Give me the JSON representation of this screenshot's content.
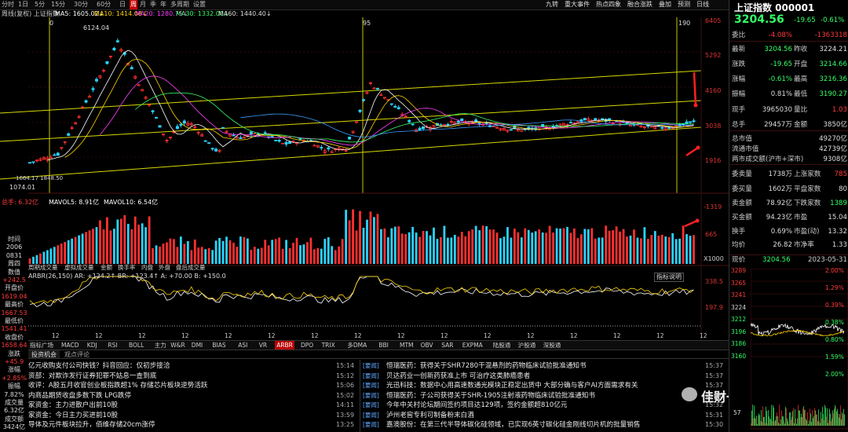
{
  "toolbar": {
    "timeframes": [
      "分时",
      "1日",
      "5分",
      "15分",
      "30分",
      "60分",
      "日",
      "周",
      "月",
      "季",
      "年",
      "多周期",
      "设置"
    ],
    "active_tf": "周",
    "right_items": [
      "九转",
      "重大事件",
      "热点四象",
      "融合涨跌",
      "叠加",
      "预测",
      "日线"
    ]
  },
  "legend": {
    "name": "周线(复权) 上证指数",
    "ma5": "MA5: 1605.02↓",
    "ma10": "MA10: 1414.08↓",
    "ma20": "MA20: 1280.75↓",
    "ma30": "MA30: 1332.00↓",
    "ma60": "MA60: 1440.40↓"
  },
  "chart_axis": {
    "price_labels": [
      "6405",
      "5292",
      "4160",
      "3038",
      "1916"
    ],
    "price_right_labels": [
      "-1319",
      "665"
    ],
    "vol_unit": "X1000",
    "ind_labels": [
      "338.5",
      "197.9"
    ],
    "peak_label": "6124.04",
    "low_label": "1074.01",
    "low_label2": "1664.17 1848.50",
    "markers": [
      "0",
      "95",
      "190"
    ]
  },
  "volume_legend": {
    "total": "总手: 6.32亿",
    "mavol5": "MAVOL5: 8.91亿",
    "mavol10": "MAVOL10: 6.54亿"
  },
  "sub_tabs": [
    "周期成交量",
    "虚拟成交量",
    "金额",
    "换手率",
    "内盘",
    "外盘",
    "盘后成交量"
  ],
  "indicator": {
    "label": "ARBR(26,150) AR: +124.2↑ BR: +123.4↑ A: +70.00 B: +150.0",
    "explain": "指标说明",
    "ticks": [
      "12",
      "12",
      "12",
      "12",
      "12",
      "12",
      "12",
      "12",
      "12",
      "12",
      "12",
      "12",
      "12",
      "12",
      "12",
      "12"
    ]
  },
  "indicator_tabs": [
    "指标广场",
    "MACD",
    "KDJ",
    "RSI",
    "BOLL",
    "主力",
    "W&R",
    "DMI",
    "BIAS",
    "ASI",
    "VR",
    "ARBR",
    "DPO",
    "TRIX",
    "多DMA",
    "BBI",
    "MTM",
    "OBV",
    "SAR",
    "EXPMA",
    "陆股通",
    "沪股通",
    "深股通"
  ],
  "active_indicator": "ARBR",
  "left_info": [
    {
      "t": "时间",
      "c": "w"
    },
    {
      "t": "2006",
      "c": "w"
    },
    {
      "t": "0831",
      "c": "w"
    },
    {
      "t": "周四",
      "c": "w"
    },
    {
      "t": "数值",
      "c": "w"
    },
    {
      "t": "+242.5",
      "c": "r"
    },
    {
      "t": "开盘价",
      "c": "w"
    },
    {
      "t": "1619.04",
      "c": "r"
    },
    {
      "t": "最高价",
      "c": "w"
    },
    {
      "t": "1667.53",
      "c": "r"
    },
    {
      "t": "最低价",
      "c": "w"
    },
    {
      "t": "1541.41",
      "c": "r"
    },
    {
      "t": "收盘价",
      "c": "w"
    },
    {
      "t": "1658.64",
      "c": "r"
    },
    {
      "t": "涨跌",
      "c": "w"
    },
    {
      "t": "+45.9",
      "c": "r"
    },
    {
      "t": "涨幅",
      "c": "w"
    },
    {
      "t": "+2.85%",
      "c": "r"
    },
    {
      "t": "振幅",
      "c": "w"
    },
    {
      "t": "7.82%",
      "c": "w"
    },
    {
      "t": "成交量",
      "c": "w"
    },
    {
      "t": "6.32亿",
      "c": "w"
    },
    {
      "t": "成交额",
      "c": "w"
    },
    {
      "t": "3424亿",
      "c": "w"
    }
  ],
  "news_tabs": [
    "投资机会",
    "观点评论"
  ],
  "news_left": [
    {
      "text": "亿元收购支付公司快钱？抖音回应：仅初步接洽",
      "time": "15:14"
    },
    {
      "text": "资部：对欺诈发行证券犯罪不姑息一查到底",
      "time": "15:12"
    },
    {
      "text": "收评：A股五月收官创业板指跌超1% 存储芯片板块逆势活跃",
      "time": "15:06"
    },
    {
      "text": "内商品期货收盘多数下跌 LPG跌停",
      "time": "15:02"
    },
    {
      "text": "家资金：主力进散户出前10股",
      "time": "14:11"
    },
    {
      "text": "家资金：今日主力买进前10股",
      "time": "13:59"
    },
    {
      "text": "导体及元件板块拉升，佰维存储20cm涨停",
      "time": "13:25"
    }
  ],
  "news_right": [
    {
      "tag": "[要闻]",
      "text": "恒瑞医药：获得关于SHR7280干混悬剂的药物临床试验批准通知书",
      "time": "15:37"
    },
    {
      "tag": "[要闻]",
      "text": "贝达药业一创新药获准上市 可治疗这类肺癌患者",
      "time": "15:37"
    },
    {
      "tag": "[要闻]",
      "text": "光迅科技：数据中心用高速数通光模块正稳定出货中 大部分确与客户AI方面需求有关",
      "time": "15:37"
    },
    {
      "tag": "[要闻]",
      "text": "恒瑞医药：子公司获得关于SHR-1905注射液药物临床试验批准通知书",
      "time": "15:36"
    },
    {
      "tag": "[要闻]",
      "text": "今年中关村论坛期间签约项目达129项，签约金额超810亿元",
      "time": "15:32"
    },
    {
      "tag": "[要闻]",
      "text": "泸州老窖专利可制备粉末白酒",
      "time": "15:31"
    },
    {
      "tag": "[要闻]",
      "text": "嘉澳股份：在第三代半导体碳化硅领域，已实现6英寸碳化硅金刚线切片机的批量销售",
      "time": "15:30"
    }
  ],
  "watermark": "佳财一分钟",
  "panel": {
    "title": "上证指数 000001",
    "price": "3204.56",
    "change": "-19.65",
    "pct": "-0.61%",
    "rows": [
      {
        "l": "委比",
        "v": "-4.08%",
        "vc": "r",
        "l2": "",
        "v2": "-1363318",
        "v2c": "r"
      },
      {
        "l": "最新",
        "v": "3204.56",
        "vc": "g",
        "l2": "昨收",
        "v2": "3224.21",
        "v2c": "w"
      },
      {
        "l": "涨跌",
        "v": "-19.65",
        "vc": "g",
        "l2": "开盘",
        "v2": "3214.66",
        "v2c": "g"
      },
      {
        "l": "涨幅",
        "v": "-0.61%",
        "vc": "g",
        "l2": "最高",
        "v2": "3216.36",
        "v2c": "g"
      },
      {
        "l": "振幅",
        "v": "0.81%",
        "vc": "w",
        "l2": "最低",
        "v2": "3190.27",
        "v2c": "g"
      },
      {
        "l": "现手",
        "v": "3965030",
        "vc": "w",
        "l2": "量比",
        "v2": "1.03",
        "v2c": "r"
      },
      {
        "l": "总手",
        "v": "29457万",
        "vc": "w",
        "l2": "金额",
        "v2": "3850亿",
        "v2c": "w"
      },
      {
        "l": "总市值",
        "v": "",
        "vc": "w",
        "l2": "",
        "v2": "49270亿",
        "v2c": "w"
      },
      {
        "l": "流通市值",
        "v": "",
        "vc": "w",
        "l2": "",
        "v2": "42739亿",
        "v2c": "w"
      },
      {
        "l": "两市成交额(沪市+深市)",
        "v": "",
        "vc": "w",
        "l2": "",
        "v2": "9308亿",
        "v2c": "w"
      },
      {
        "l": "委卖量",
        "v": "1738万",
        "vc": "w",
        "l2": "上涨家数",
        "v2": "785",
        "v2c": "r"
      },
      {
        "l": "委买量",
        "v": "1602万",
        "vc": "w",
        "l2": "平盘家数",
        "v2": "80",
        "v2c": "w"
      },
      {
        "l": "卖金额",
        "v": "78.92亿",
        "vc": "w",
        "l2": "下跌家数",
        "v2": "1389",
        "v2c": "g"
      },
      {
        "l": "买金额",
        "v": "94.23亿",
        "vc": "w",
        "l2": "市盈",
        "v2": "15.04",
        "v2c": "w"
      },
      {
        "l": "换手",
        "v": "0.69%",
        "vc": "w",
        "l2": "市盈(动)",
        "v2": "13.32",
        "v2c": "w"
      },
      {
        "l": "均价",
        "v": "26.82",
        "vc": "w",
        "l2": "市净率",
        "v2": "1.33",
        "v2c": "w"
      }
    ],
    "mini_header_l": "现价",
    "mini_header_p": "3204.56",
    "mini_header_d": "2023-05-31",
    "mini_left": [
      "3289",
      "3265",
      "3241",
      "3224",
      "3212",
      "3196",
      "3186",
      "3160"
    ],
    "mini_right": [
      "2.00%",
      "1.29%",
      "0.39%",
      "0.38%",
      "0.80%",
      "1.59%",
      "2.00%"
    ],
    "mini_vol_label": "57"
  }
}
